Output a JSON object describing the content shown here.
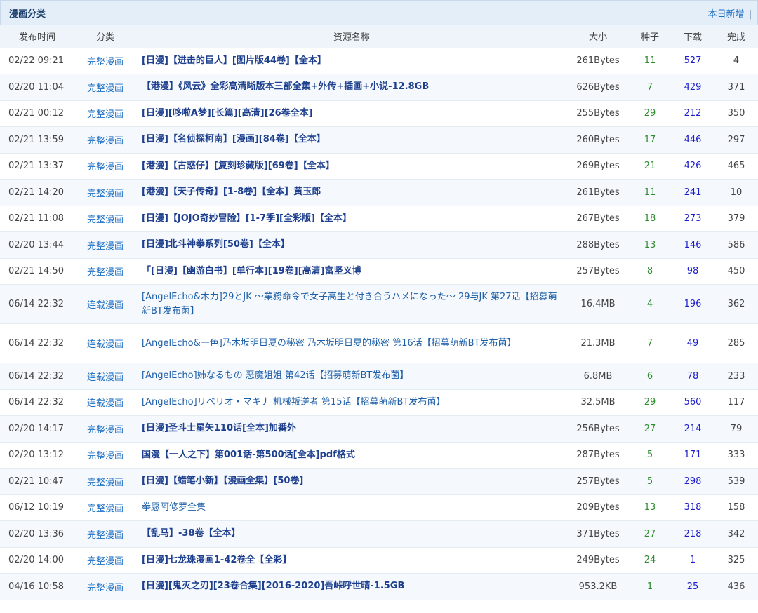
{
  "header": {
    "title": "漫画分类",
    "right_link": "本日新增",
    "separator": "|"
  },
  "columns": {
    "time": "发布时间",
    "cat": "分类",
    "name": "资源名称",
    "size": "大小",
    "seed": "种子",
    "dl": "下载",
    "done": "完成"
  },
  "rows": [
    {
      "time": "02/22 09:21",
      "cat": "完整漫画",
      "name": "[日漫]【进击的巨人】[图片版44卷]【全本】",
      "bold": true,
      "size": "261Bytes",
      "seed": "11",
      "dl": "527",
      "done": "4"
    },
    {
      "time": "02/20 11:04",
      "cat": "完整漫画",
      "name": "【港漫】《风云》全彩高清晰版本三部全集+外传+插画+小说-12.8GB",
      "bold": true,
      "size": "626Bytes",
      "seed": "7",
      "dl": "429",
      "done": "371"
    },
    {
      "time": "02/21 00:12",
      "cat": "完整漫画",
      "name": "[日漫][哆啦A梦][长篇][高清][26卷全本]",
      "bold": true,
      "size": "255Bytes",
      "seed": "29",
      "dl": "212",
      "done": "350"
    },
    {
      "time": "02/21 13:59",
      "cat": "完整漫画",
      "name": "[日漫]【名侦探柯南】[漫画][84卷]【全本】",
      "bold": true,
      "size": "260Bytes",
      "seed": "17",
      "dl": "446",
      "done": "297"
    },
    {
      "time": "02/21 13:37",
      "cat": "完整漫画",
      "name": "[港漫]【古惑仔】[复刻珍藏版][69卷]【全本】",
      "bold": true,
      "size": "269Bytes",
      "seed": "21",
      "dl": "426",
      "done": "465"
    },
    {
      "time": "02/21 14:20",
      "cat": "完整漫画",
      "name": "[港漫]【天子传奇】[1-8卷]【全本】黄玉郎",
      "bold": true,
      "size": "261Bytes",
      "seed": "11",
      "dl": "241",
      "done": "10"
    },
    {
      "time": "02/21 11:08",
      "cat": "完整漫画",
      "name": "[日漫]【JOJO奇妙冒险】[1-7季][全彩版]【全本】",
      "bold": true,
      "size": "267Bytes",
      "seed": "18",
      "dl": "273",
      "done": "379"
    },
    {
      "time": "02/20 13:44",
      "cat": "完整漫画",
      "name": "[日漫]北斗神拳系列[50卷]【全本】",
      "bold": true,
      "size": "288Bytes",
      "seed": "13",
      "dl": "146",
      "done": "586"
    },
    {
      "time": "02/21 14:50",
      "cat": "完整漫画",
      "name": "「[日漫]【幽游白书】[单行本][19卷][高清]富坚义博",
      "bold": true,
      "size": "257Bytes",
      "seed": "8",
      "dl": "98",
      "done": "450"
    },
    {
      "time": "06/14 22:32",
      "cat": "连载漫画",
      "name": "[AngelEcho&木力]29とJK ～業務命令で女子高生と付き合うハメになった～ 29与JK 第27话【招募萌新BT发布菌】",
      "bold": false,
      "tall": true,
      "size": "16.4MB",
      "seed": "4",
      "dl": "196",
      "done": "362"
    },
    {
      "time": "06/14 22:32",
      "cat": "连载漫画",
      "name": "[AngelEcho&一色]乃木坂明日夏の秘密 乃木坂明日夏的秘密 第16话【招募萌新BT发布菌】",
      "bold": false,
      "tall": true,
      "size": "21.3MB",
      "seed": "7",
      "dl": "49",
      "done": "285"
    },
    {
      "time": "06/14 22:32",
      "cat": "连载漫画",
      "name": "[AngelEcho]姉なるもの 恶魔姐姐 第42话【招募萌新BT发布菌】",
      "bold": false,
      "size": "6.8MB",
      "seed": "6",
      "dl": "78",
      "done": "233"
    },
    {
      "time": "06/14 22:32",
      "cat": "连载漫画",
      "name": "[AngelEcho]リベリオ・マキナ 机械叛逆者 第15话【招募萌新BT发布菌】",
      "bold": false,
      "size": "32.5MB",
      "seed": "29",
      "dl": "560",
      "done": "117"
    },
    {
      "time": "02/20 14:17",
      "cat": "完整漫画",
      "name": "[日漫]圣斗士星矢110话[全本]加番外",
      "bold": true,
      "size": "256Bytes",
      "seed": "27",
      "dl": "214",
      "done": "79"
    },
    {
      "time": "02/20 13:12",
      "cat": "完整漫画",
      "name": "国漫【一人之下】第001话-第500话[全本]pdf格式",
      "bold": true,
      "size": "287Bytes",
      "seed": "5",
      "dl": "171",
      "done": "333"
    },
    {
      "time": "02/21 10:47",
      "cat": "完整漫画",
      "name": "[日漫]【蜡笔小新】【漫画全集】[50卷]",
      "bold": true,
      "size": "257Bytes",
      "seed": "5",
      "dl": "298",
      "done": "539"
    },
    {
      "time": "06/12 10:19",
      "cat": "完整漫画",
      "name": "拳愿阿修罗全集",
      "bold": false,
      "size": "209Bytes",
      "seed": "13",
      "dl": "318",
      "done": "158"
    },
    {
      "time": "02/20 13:36",
      "cat": "完整漫画",
      "name": "【乱马】-38卷【全本】",
      "bold": true,
      "size": "371Bytes",
      "seed": "27",
      "dl": "218",
      "done": "342"
    },
    {
      "time": "02/20 14:00",
      "cat": "完整漫画",
      "name": "[日漫]七龙珠漫画1-42卷全【全彩】",
      "bold": true,
      "size": "249Bytes",
      "seed": "24",
      "dl": "1",
      "done": "325"
    },
    {
      "time": "04/16 10:58",
      "cat": "完整漫画",
      "name": "[日漫][鬼灭之刃][23卷合集][2016-2020]吾峠呼世晴-1.5GB",
      "bold": true,
      "size": "953.2KB",
      "seed": "1",
      "dl": "25",
      "done": "436"
    }
  ]
}
